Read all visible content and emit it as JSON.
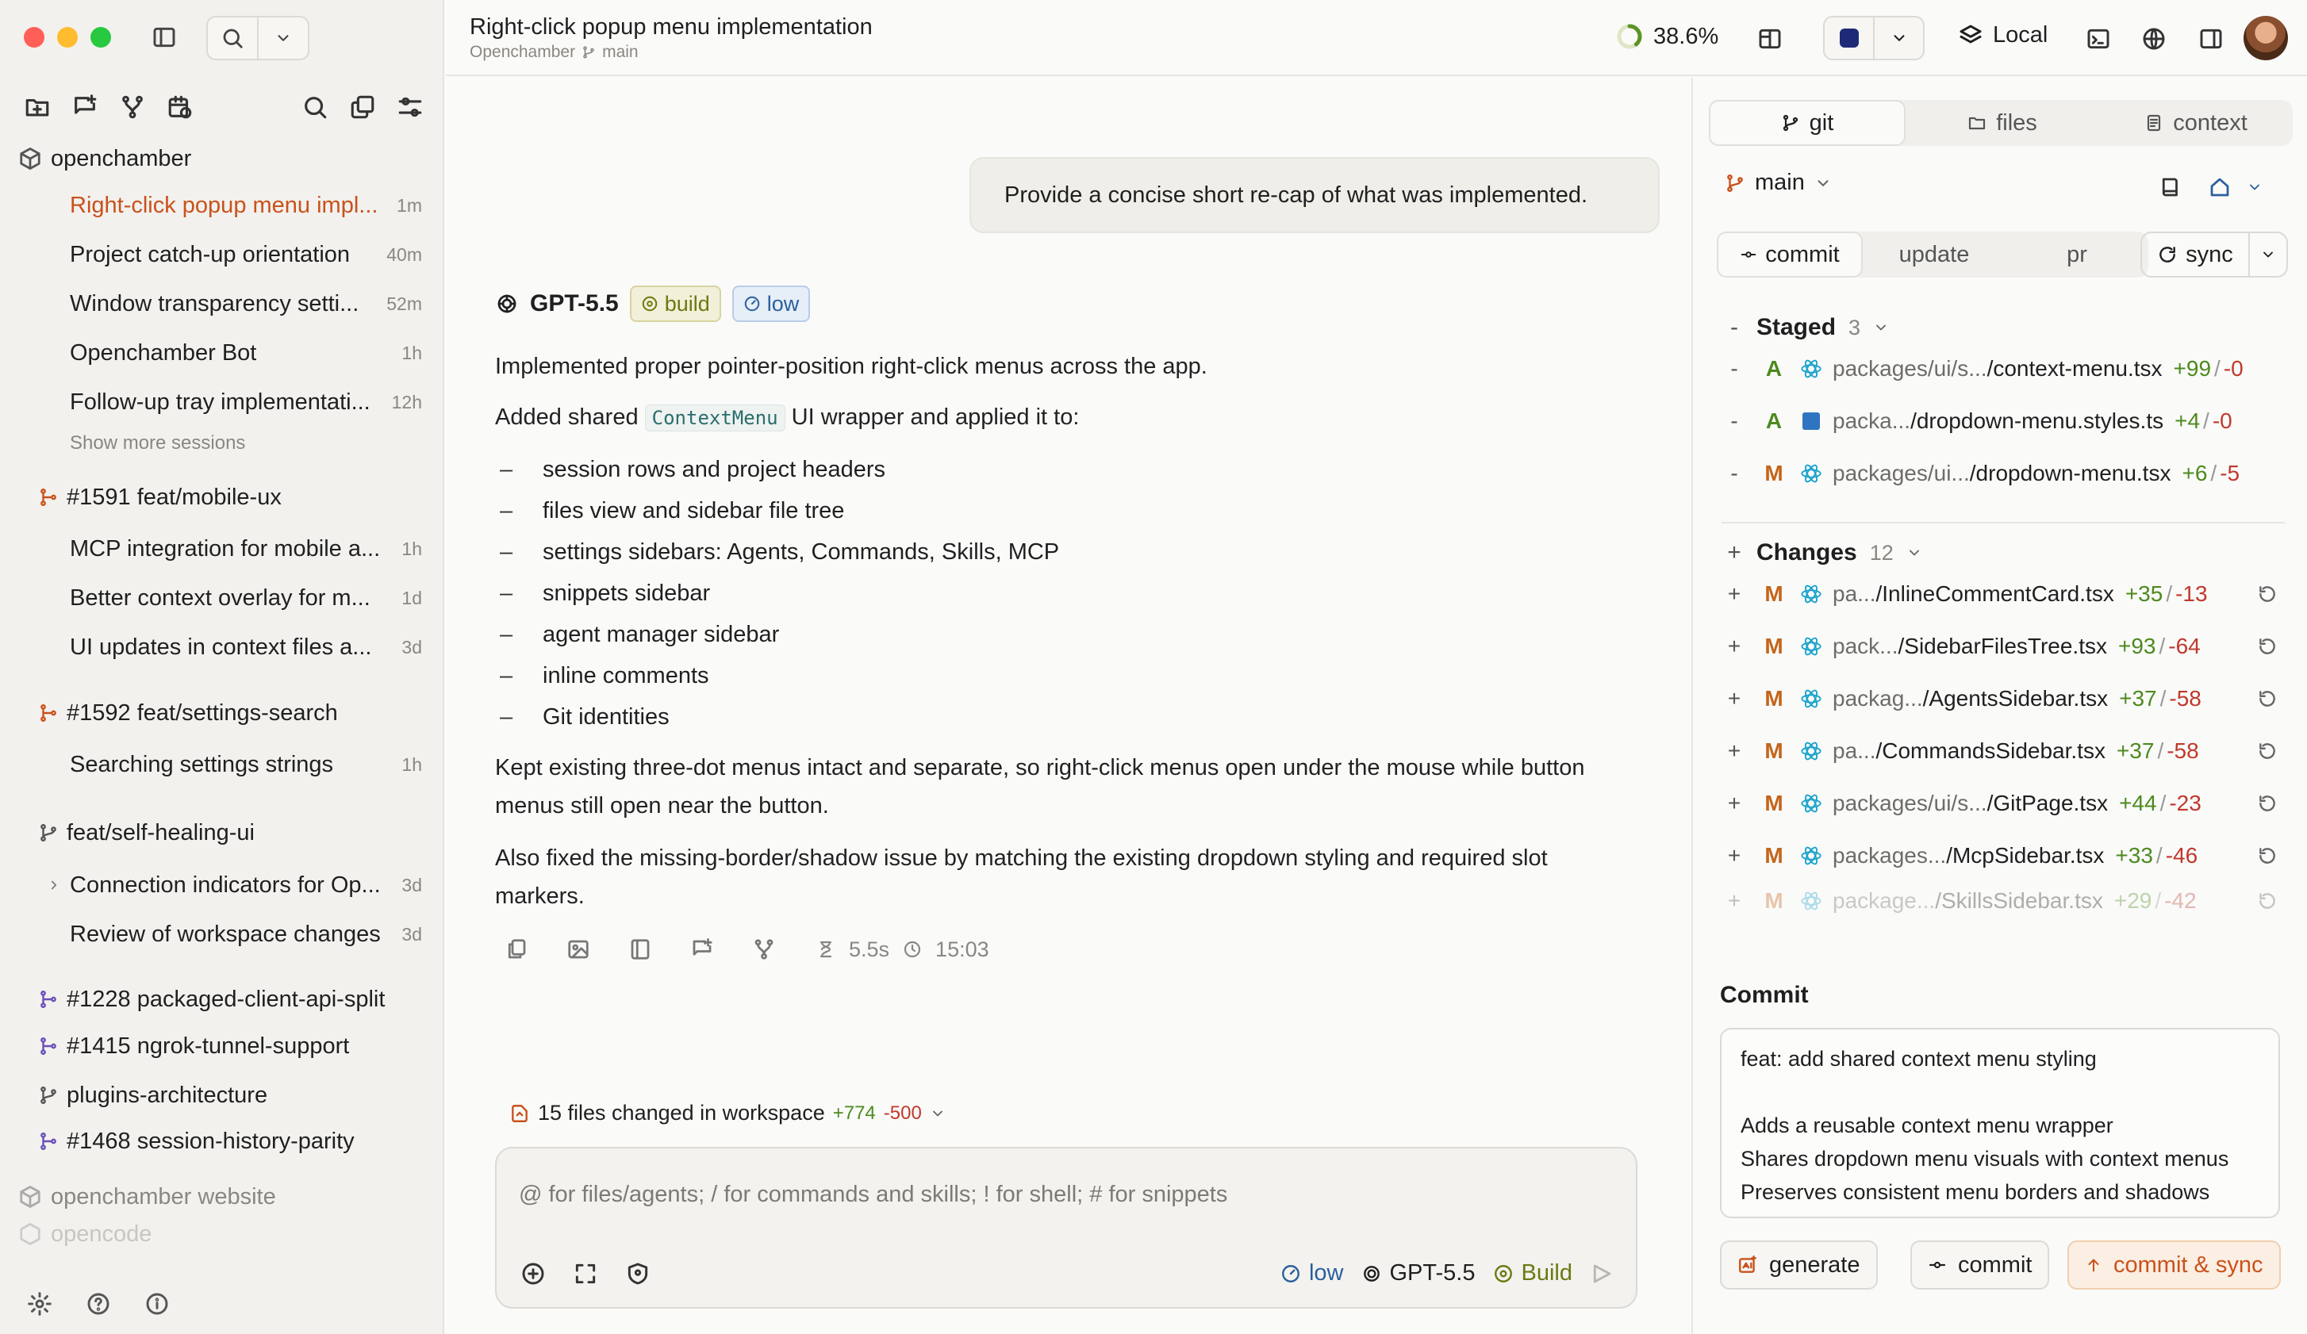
{
  "window": {
    "title": "Right-click popup menu implementation",
    "project": "Openchamber",
    "branch": "main"
  },
  "header": {
    "progress": "38.6%",
    "location": "Local"
  },
  "sidebar": {
    "project": "openchamber",
    "sessions": [
      {
        "title": "Right-click popup menu impl...",
        "time": "1m",
        "active": true
      },
      {
        "title": "Project catch-up orientation",
        "time": "40m"
      },
      {
        "title": "Window transparency setti...",
        "time": "52m"
      },
      {
        "title": "Openchamber Bot",
        "time": "1h"
      },
      {
        "title": "Follow-up tray implementati...",
        "time": "12h"
      }
    ],
    "show_more": "Show more sessions",
    "group1": {
      "name": "#1591 feat/mobile-ux",
      "sessions": [
        {
          "title": "MCP integration for mobile a...",
          "time": "1h"
        },
        {
          "title": "Better context overlay for m...",
          "time": "1d"
        },
        {
          "title": "UI updates in context files a...",
          "time": "3d"
        }
      ]
    },
    "group2": {
      "name": "#1592 feat/settings-search",
      "sessions": [
        {
          "title": "Searching settings strings",
          "time": "1h"
        }
      ]
    },
    "group3": {
      "name": "feat/self-healing-ui",
      "sessions": [
        {
          "title": "Connection indicators for Op...",
          "time": "3d"
        },
        {
          "title": "Review of workspace changes",
          "time": "3d"
        }
      ]
    },
    "branches": [
      "#1228 packaged-client-api-split",
      "#1415 ngrok-tunnel-support",
      "plugins-architecture",
      "#1468 session-history-parity"
    ],
    "other_projects": [
      "openchamber website",
      "opencode"
    ]
  },
  "chat": {
    "user_message": "Provide a concise short re-cap of what was implemented.",
    "model": "GPT-5.5",
    "mode_badge": "build",
    "effort_badge": "low",
    "p1": "Implemented proper pointer-position right-click menus across the app.",
    "p2_pre": "Added shared",
    "p2_code": "ContextMenu",
    "p2_post": "UI wrapper and applied it to:",
    "bullets": [
      "session rows and project headers",
      "files view and sidebar file tree",
      "settings sidebars: Agents, Commands, Skills, MCP",
      "snippets sidebar",
      "agent manager sidebar",
      "inline comments",
      "Git identities"
    ],
    "p3": "Kept existing three-dot menus intact and separate, so right-click menus open under the mouse while button menus still open near the button.",
    "p4": "Also fixed the missing-border/shadow issue by matching the existing dropdown styling and required slot markers.",
    "duration": "5.5s",
    "timestamp": "15:03",
    "files_changed": "15 files changed in workspace",
    "added": "+774",
    "removed": "-500",
    "composer_placeholder": "@ for files/agents; / for commands and skills; ! for shell; # for snippets",
    "composer_effort": "low",
    "composer_model": "GPT-5.5",
    "composer_mode": "Build"
  },
  "panel": {
    "tabs": [
      "git",
      "files",
      "context"
    ],
    "branch": "main",
    "segments": [
      "commit",
      "update",
      "pr"
    ],
    "sync": "sync",
    "staged_label": "Staged",
    "staged_count": "3",
    "staged": [
      {
        "status": "A",
        "path": "packages/ui/s...",
        "name": "/context-menu.tsx",
        "add": "+99",
        "del": "-0",
        "type": "react"
      },
      {
        "status": "A",
        "path": "packa...",
        "name": "/dropdown-menu.styles.ts",
        "add": "+4",
        "del": "-0",
        "type": "ts"
      },
      {
        "status": "M",
        "path": "packages/ui...",
        "name": "/dropdown-menu.tsx",
        "add": "+6",
        "del": "-5",
        "type": "react"
      }
    ],
    "changes_label": "Changes",
    "changes_count": "12",
    "changes": [
      {
        "status": "M",
        "path": "pa...",
        "name": "/InlineCommentCard.tsx",
        "add": "+35",
        "del": "-13"
      },
      {
        "status": "M",
        "path": "pack...",
        "name": "/SidebarFilesTree.tsx",
        "add": "+93",
        "del": "-64"
      },
      {
        "status": "M",
        "path": "packag...",
        "name": "/AgentsSidebar.tsx",
        "add": "+37",
        "del": "-58"
      },
      {
        "status": "M",
        "path": "pa...",
        "name": "/CommandsSidebar.tsx",
        "add": "+37",
        "del": "-58"
      },
      {
        "status": "M",
        "path": "packages/ui/s...",
        "name": "/GitPage.tsx",
        "add": "+44",
        "del": "-23"
      },
      {
        "status": "M",
        "path": "packages...",
        "name": "/McpSidebar.tsx",
        "add": "+33",
        "del": "-46"
      },
      {
        "status": "M",
        "path": "package...",
        "name": "/SkillsSidebar.tsx",
        "add": "+29",
        "del": "-42"
      }
    ],
    "commit_label": "Commit",
    "commit_title": "feat: add shared context menu styling",
    "commit_body": [
      "Adds a reusable context menu wrapper",
      "Shares dropdown menu visuals with context menus",
      "Preserves consistent menu borders and shadows"
    ],
    "btn_generate": "generate",
    "btn_commit": "commit",
    "btn_commit_sync": "commit & sync"
  },
  "colors": {
    "accent": "#c9521b",
    "added": "#4d8a1e",
    "removed": "#c0392b",
    "modified": "#c4651b",
    "build": "#6b7a10",
    "low": "#2b5f9e"
  }
}
